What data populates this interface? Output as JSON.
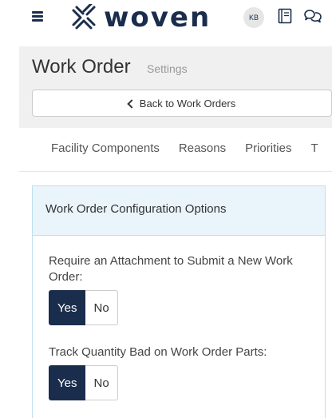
{
  "header": {
    "logo_text": "woven",
    "user_initials": "KB"
  },
  "page": {
    "title": "Work Order",
    "subtitle": "Settings",
    "back_label": "Back to Work Orders"
  },
  "tabs": [
    {
      "label": "Facility Components"
    },
    {
      "label": "Reasons"
    },
    {
      "label": "Priorities"
    },
    {
      "label": "T"
    }
  ],
  "panel": {
    "title": "Work Order Configuration Options",
    "options": [
      {
        "label": "Require an Attachment to Submit a New Work Order:",
        "yes_label": "Yes",
        "no_label": "No",
        "selected": "Yes"
      },
      {
        "label": "Track Quantity Bad on Work Order Parts:",
        "yes_label": "Yes",
        "no_label": "No",
        "selected": "Yes"
      }
    ]
  },
  "colors": {
    "brand_navy": "#1b2d4c",
    "panel_header_bg": "#eaf4fb",
    "panel_border": "#bfe0ee"
  },
  "icons": {
    "menu": "hamburger-menu-icon",
    "logo": "woven-logo-mark-icon",
    "notebook": "notebook-icon",
    "chat": "chat-bubbles-icon",
    "back": "chevron-left-icon"
  }
}
